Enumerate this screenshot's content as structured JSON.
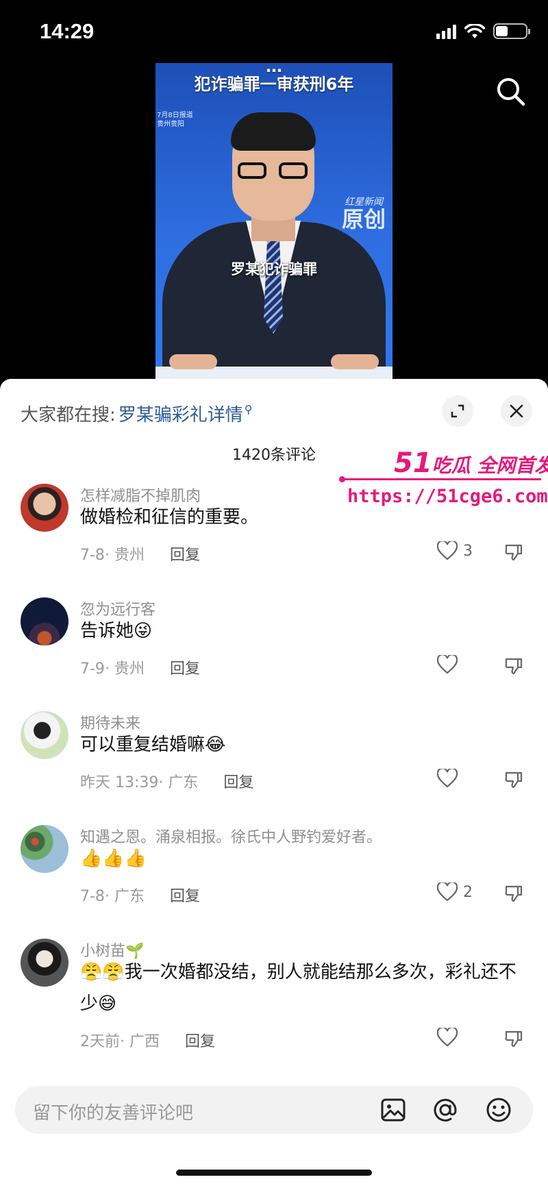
{
  "status_bar": {
    "time": "14:29",
    "battery_level": 0.4
  },
  "video": {
    "title_line1": "…",
    "title_line2": "犯诈骗罪一审获刑6年",
    "meta_line1": "7月8日报道",
    "meta_line2": "贵州贵阳",
    "caption": "罗某犯诈骗罪",
    "logo_small": "红星新闻",
    "logo_big": "原创"
  },
  "sheet": {
    "hot_search_label": "大家都在搜:",
    "hot_search_keyword": "罗某骗彩礼详情",
    "comment_count": "1420条评论"
  },
  "comments": [
    {
      "user": "怎样减脂不掉肌肉",
      "text": "做婚检和征信的重要。",
      "date": "7-8",
      "location": "贵州",
      "reply": "回复",
      "likes": "3"
    },
    {
      "user": "忽为远行客",
      "text": "告诉她😜",
      "date": "7-9",
      "location": "贵州",
      "reply": "回复",
      "likes": ""
    },
    {
      "user": "期待未来",
      "text": "可以重复结婚嘛😂",
      "date": "昨天 13:39",
      "location": "广东",
      "reply": "回复",
      "likes": ""
    },
    {
      "user": "知遇之恩。涌泉相报。徐氏中人野钓爱好者。",
      "text": "👍👍👍",
      "date": "7-8",
      "location": "广东",
      "reply": "回复",
      "likes": "2"
    },
    {
      "user": "小树苗🌱",
      "text": "😤😤我一次婚都没结，别人就能结那么多次，彩礼还不少😅",
      "date": "2天前",
      "location": "广西",
      "reply": "回复",
      "likes": ""
    }
  ],
  "watermark": {
    "title_num": "51",
    "title_text": "吃瓜 全网首发",
    "url": "https://51cge6.com"
  },
  "input": {
    "placeholder": "留下你的友善评论吧"
  },
  "icons": [
    "search-icon",
    "expand-icon",
    "close-icon",
    "heart-icon",
    "dislike-icon",
    "image-icon",
    "at-icon",
    "emoji-icon"
  ]
}
